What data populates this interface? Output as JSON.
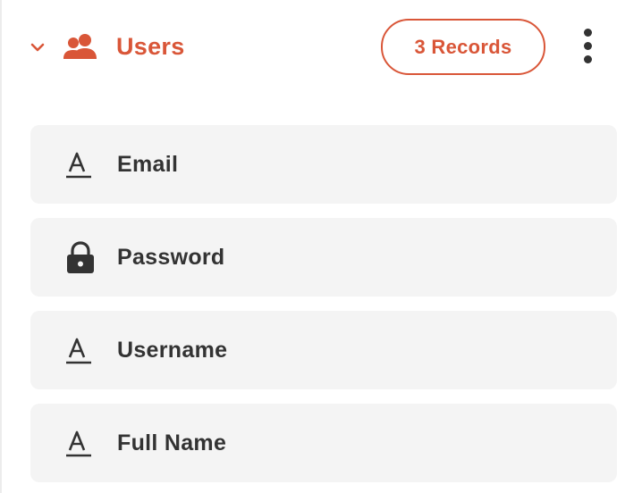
{
  "collection": {
    "title": "Users",
    "records_label": "3 Records",
    "icon": "users-icon",
    "expanded": true
  },
  "colors": {
    "accent": "#d95638",
    "row_background": "#f4f4f4",
    "text": "#333333"
  },
  "fields": [
    {
      "label": "Email",
      "icon": "text-type-icon"
    },
    {
      "label": "Password",
      "icon": "lock-icon"
    },
    {
      "label": "Username",
      "icon": "text-type-icon"
    },
    {
      "label": "Full Name",
      "icon": "text-type-icon"
    }
  ]
}
